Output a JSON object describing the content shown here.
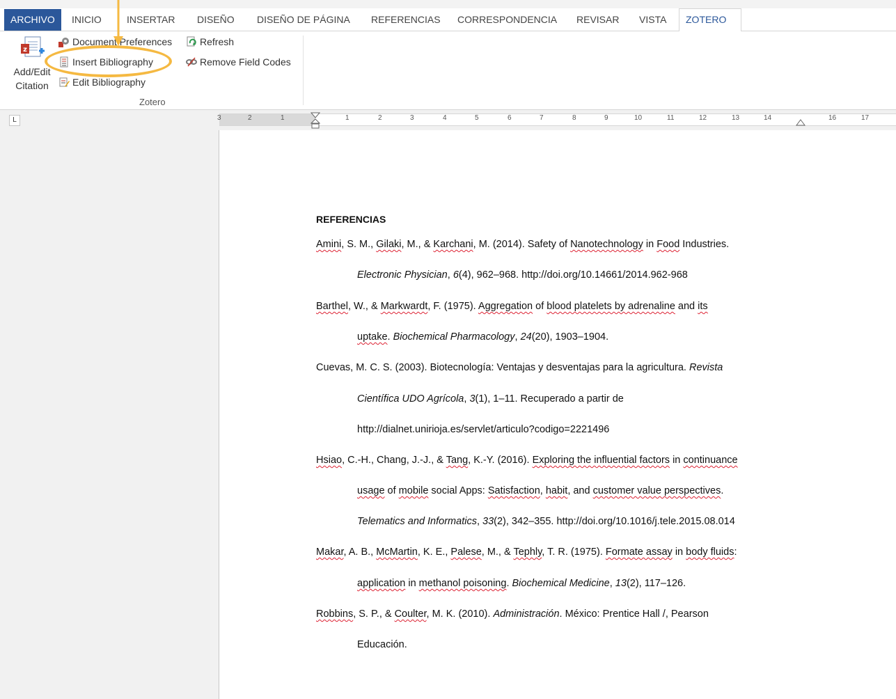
{
  "tabs": [
    "ARCHIVO",
    "INICIO",
    "INSERTAR",
    "DISEÑO",
    "DISEÑO DE PÁGINA",
    "REFERENCIAS",
    "CORRESPONDENCIA",
    "REVISAR",
    "VISTA",
    "ZOTERO"
  ],
  "ribbon": {
    "add_edit_line1": "Add/Edit",
    "add_edit_line2": "Citation",
    "document_preferences": "Document Preferences",
    "insert_bibliography": "Insert Bibliography",
    "edit_bibliography": "Edit Bibliography",
    "refresh": "Refresh",
    "remove_field_codes": "Remove Field Codes",
    "group_label": "Zotero"
  },
  "ruler_numbers": [
    "3",
    "2",
    "1",
    "1",
    "2",
    "3",
    "4",
    "5",
    "6",
    "7",
    "8",
    "9",
    "10",
    "11",
    "12",
    "13",
    "14",
    "16",
    "17"
  ],
  "tab_selector": "L",
  "document": {
    "title": "REFERENCIAS",
    "lines": [
      {
        "p": [
          "Amini",
          "Amini, S. M., "
        ],
        "segs": [
          [
            "sq",
            "Amini"
          ],
          [
            "t",
            ", S. M., "
          ],
          [
            "sq",
            "Gilaki"
          ],
          [
            "t",
            ", M., & "
          ],
          [
            "sq",
            "Karchani"
          ],
          [
            "t",
            ", M. (2014). Safety of "
          ],
          [
            "sq",
            "Nanotechnology"
          ],
          [
            "t",
            " in "
          ],
          [
            "sq",
            "Food"
          ],
          [
            "t",
            " Industries."
          ]
        ]
      },
      {
        "segs": [
          [
            "i",
            "Electronic Physician"
          ],
          [
            "t",
            ", "
          ],
          [
            "i",
            "6"
          ],
          [
            "t",
            "(4), 962–968. http://doi.org/10.14661/2014.962-968"
          ]
        ]
      },
      {
        "segs": [
          [
            "sq",
            "Barthel"
          ],
          [
            "t",
            ", W., & "
          ],
          [
            "sq",
            "Markwardt"
          ],
          [
            "t",
            ", F. (1975). "
          ],
          [
            "sq",
            "Aggregation"
          ],
          [
            "t",
            " of "
          ],
          [
            "sq",
            "blood platelets by adrenaline"
          ],
          [
            "t",
            " and "
          ],
          [
            "sq",
            "its"
          ]
        ]
      },
      {
        "segs": [
          [
            "sq",
            "uptake"
          ],
          [
            "t",
            ". "
          ],
          [
            "i",
            "Biochemical Pharmacology"
          ],
          [
            "t",
            ", "
          ],
          [
            "i",
            "24"
          ],
          [
            "t",
            "(20), 1903–1904."
          ]
        ]
      },
      {
        "segs": [
          [
            "t",
            "Cuevas, M. C. S. (2003). Biotecnología: Ventajas y desventajas para la agricultura. "
          ],
          [
            "i",
            "Revista"
          ]
        ]
      },
      {
        "segs": [
          [
            "i",
            "Científica UDO Agrícola"
          ],
          [
            "t",
            ", "
          ],
          [
            "i",
            "3"
          ],
          [
            "t",
            "(1), 1–11. Recuperado a partir de"
          ]
        ]
      },
      {
        "segs": [
          [
            "t",
            "http://dialnet.unirioja.es/servlet/articulo?codigo=2221496"
          ]
        ]
      },
      {
        "segs": [
          [
            "sq",
            "Hsiao"
          ],
          [
            "t",
            ", C.-H., Chang, J.-J., & "
          ],
          [
            "sq",
            "Tang"
          ],
          [
            "t",
            ", K.-Y. (2016). "
          ],
          [
            "sq",
            "Exploring the influential factors"
          ],
          [
            "t",
            " in "
          ],
          [
            "sq",
            "continuance"
          ]
        ]
      },
      {
        "segs": [
          [
            "sq",
            "usage"
          ],
          [
            "t",
            " of "
          ],
          [
            "sq",
            "mobile"
          ],
          [
            "t",
            " social Apps: "
          ],
          [
            "sq",
            "Satisfaction"
          ],
          [
            "t",
            ", "
          ],
          [
            "sq",
            "habit"
          ],
          [
            "t",
            ", and "
          ],
          [
            "sq",
            "customer value perspectives"
          ],
          [
            "t",
            "."
          ]
        ]
      },
      {
        "segs": [
          [
            "i",
            "Telematics"
          ],
          [
            "i",
            " and "
          ],
          [
            "i",
            "Informatics"
          ],
          [
            "t",
            ", "
          ],
          [
            "i",
            "33"
          ],
          [
            "t",
            "(2), 342–355. http://doi.org/10.1016/j.tele.2015.08.014"
          ]
        ]
      },
      {
        "segs": [
          [
            "sq",
            "Makar"
          ],
          [
            "t",
            ", A. B., "
          ],
          [
            "sq",
            "McMartin"
          ],
          [
            "t",
            ", K. E., "
          ],
          [
            "sq",
            "Palese"
          ],
          [
            "t",
            ", M., & "
          ],
          [
            "sq",
            "Tephly"
          ],
          [
            "t",
            ", T. R. (1975). "
          ],
          [
            "sq",
            "Formate assay"
          ],
          [
            "t",
            " in "
          ],
          [
            "sq",
            "body fluids"
          ],
          [
            "t",
            ":"
          ]
        ]
      },
      {
        "segs": [
          [
            "sq",
            "application"
          ],
          [
            "t",
            " in "
          ],
          [
            "sq",
            "methanol poisoning"
          ],
          [
            "t",
            ". "
          ],
          [
            "i",
            "Biochemical"
          ],
          [
            "i",
            " Medicine"
          ],
          [
            "t",
            ", "
          ],
          [
            "i",
            "13"
          ],
          [
            "t",
            "(2), 117–126."
          ]
        ]
      },
      {
        "segs": [
          [
            "sq",
            "Robbins"
          ],
          [
            "t",
            ", S. P., & "
          ],
          [
            "sq",
            "Coulter"
          ],
          [
            "t",
            ", M. K. (2010). "
          ],
          [
            "i",
            "Administración"
          ],
          [
            "t",
            ". México: Prentice Hall /, Pearson"
          ]
        ]
      },
      {
        "segs": [
          [
            "t",
            "Educación."
          ]
        ]
      }
    ]
  }
}
